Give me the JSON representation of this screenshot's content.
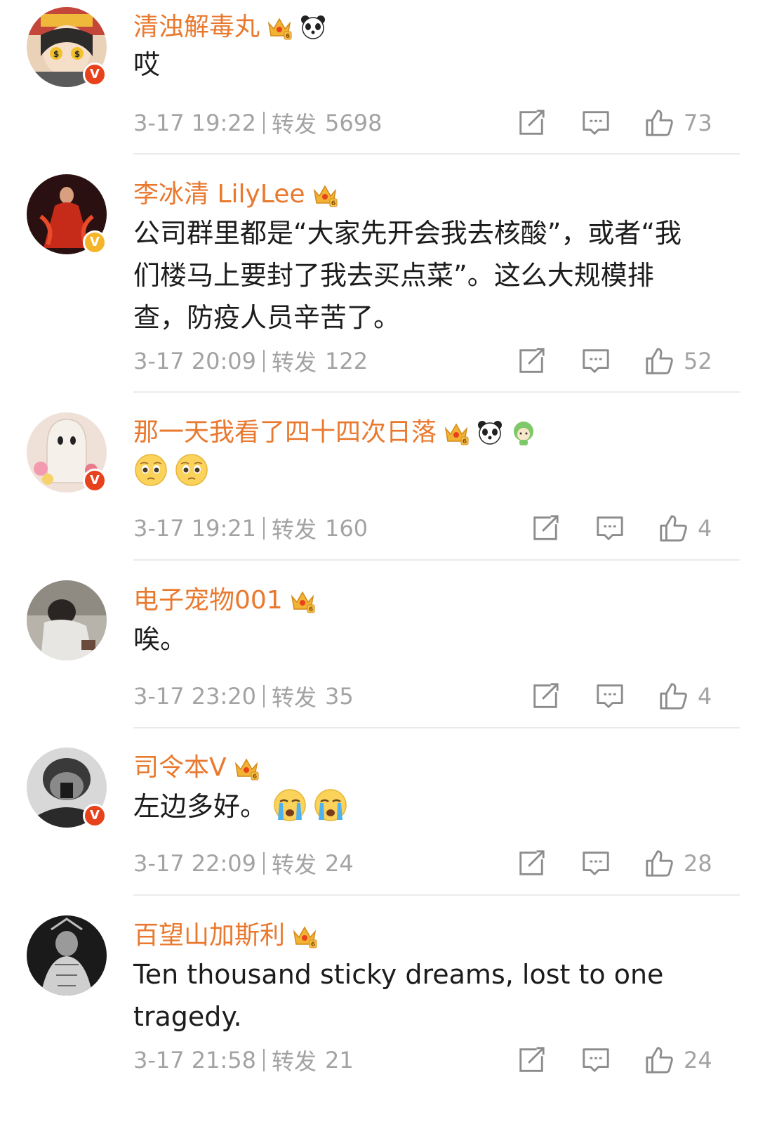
{
  "colors": {
    "username": "#e9792f",
    "meta": "#a3a3a3",
    "verified_red": "#e8421c",
    "verified_gold": "#f5b52a",
    "divider": "#ebebeb"
  },
  "comments": [
    {
      "username": "清浊解毒丸",
      "badges": [
        "vip-crown-icon",
        "panda-icon"
      ],
      "verified": "red",
      "verified_label": "V",
      "text": "哎",
      "emojis": [],
      "time": "3-17 19:22",
      "repost_label": "转发",
      "repost_count": "5698",
      "likes": "73"
    },
    {
      "username": "李冰清 LilyLee",
      "badges": [
        "vip-crown-icon"
      ],
      "verified": "gold",
      "verified_label": "V",
      "text": "公司群里都是“大家先开会我去核酸”，或者“我们楼马上要封了我去买点菜”。这么大规模排查，防疫人员辛苦了。",
      "emojis": [],
      "time": "3-17 20:09",
      "repost_label": "转发",
      "repost_count": "122",
      "likes": "52"
    },
    {
      "username": "那一天我看了四十四次日落",
      "badges": [
        "vip-crown-icon",
        "panda-icon",
        "green-mascot-icon"
      ],
      "verified": "red",
      "verified_label": "V",
      "text": "",
      "emojis": [
        "pleading-face-emoji",
        "pleading-face-emoji"
      ],
      "time": "3-17 19:21",
      "repost_label": "转发",
      "repost_count": "160",
      "likes": "4"
    },
    {
      "username": "电子宠物001",
      "badges": [
        "vip-crown-icon"
      ],
      "verified": "none",
      "verified_label": "",
      "text": "唉。",
      "emojis": [],
      "time": "3-17 23:20",
      "repost_label": "转发",
      "repost_count": "35",
      "likes": "4"
    },
    {
      "username": "司令本V",
      "badges": [
        "vip-crown-icon"
      ],
      "verified": "red",
      "verified_label": "V",
      "text": "左边多好。",
      "emojis": [
        "crying-face-emoji",
        "crying-face-emoji"
      ],
      "time": "3-17 22:09",
      "repost_label": "转发",
      "repost_count": "24",
      "likes": "28"
    },
    {
      "username": "百望山加斯利",
      "badges": [
        "vip-crown-icon"
      ],
      "verified": "none",
      "verified_label": "",
      "text": "Ten thousand sticky dreams, lost to one tragedy.",
      "emojis": [],
      "time": "3-17 21:58",
      "repost_label": "转发",
      "repost_count": "21",
      "likes": "24"
    }
  ]
}
